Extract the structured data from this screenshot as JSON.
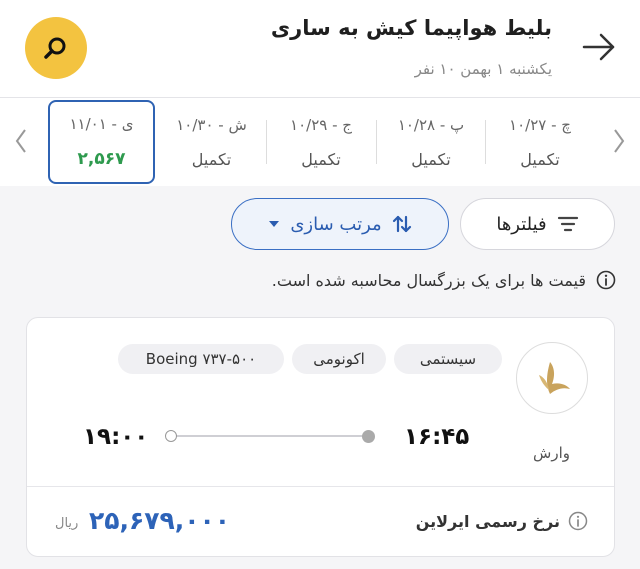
{
  "header": {
    "title": "بلیط هواپیما کیش به ساری",
    "subtitle": "یکشنبه ۱ بهمن ۱۰ نفر"
  },
  "dates": [
    {
      "date": "چ - ۱۰/۲۷",
      "status": "تکمیل"
    },
    {
      "date": "پ - ۱۰/۲۸",
      "status": "تکمیل"
    },
    {
      "date": "ج - ۱۰/۲۹",
      "status": "تکمیل"
    },
    {
      "date": "ش - ۱۰/۳۰",
      "status": "تکمیل"
    },
    {
      "date": "ی - ۱۱/۰۱",
      "status": "۲,۵۶۷",
      "selected": true
    }
  ],
  "controls": {
    "filters_label": "فیلترها",
    "sort_label": "مرتب سازی"
  },
  "note": "قیمت ها برای یک بزرگسال محاسبه شده است.",
  "flight": {
    "airline": "وارش",
    "type": "سیستمی",
    "class": "اکونومی",
    "aircraft": "Boeing ۷۳۷-۵۰۰",
    "departure": "۱۶:۴۵",
    "arrival": "۱۹:۰۰",
    "fare_label": "نرخ رسمی ایرلاین",
    "price": "۲۵,۶۷۹,۰۰۰",
    "currency": "ریال"
  },
  "colors": {
    "accent_blue": "#2d63b8",
    "search_yellow": "#f3c340",
    "seats_green": "#2e9a4e"
  },
  "icons": [
    "search-icon",
    "arrow-right-icon",
    "chevron-left-icon",
    "chevron-right-icon",
    "filter-icon",
    "sort-icon",
    "caret-down-icon",
    "info-icon",
    "airline-logo"
  ]
}
